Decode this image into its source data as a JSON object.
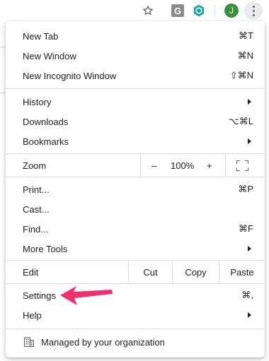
{
  "toolbar": {
    "star_icon": "star-icon",
    "ext_g_letter": "G",
    "avatar_letter": "J",
    "colors": {
      "avatar": "#3c8f3c",
      "ext_hex": "#1aa5a5"
    }
  },
  "menu": {
    "group1": [
      {
        "label": "New Tab",
        "shortcut": "⌘T"
      },
      {
        "label": "New Window",
        "shortcut": "⌘N"
      },
      {
        "label": "New Incognito Window",
        "shortcut": "⇧⌘N"
      }
    ],
    "group2": [
      {
        "label": "History",
        "submenu": true
      },
      {
        "label": "Downloads",
        "shortcut": "⌥⌘L"
      },
      {
        "label": "Bookmarks",
        "submenu": true
      }
    ],
    "zoom": {
      "label": "Zoom",
      "minus": "–",
      "value": "100%",
      "plus": "+"
    },
    "group3": [
      {
        "label": "Print...",
        "shortcut": "⌘P"
      },
      {
        "label": "Cast..."
      },
      {
        "label": "Find...",
        "shortcut": "⌘F"
      },
      {
        "label": "More Tools",
        "submenu": true
      }
    ],
    "edit": {
      "label": "Edit",
      "cut": "Cut",
      "copy": "Copy",
      "paste": "Paste"
    },
    "group4": [
      {
        "label": "Settings",
        "shortcut": "⌘,"
      },
      {
        "label": "Help",
        "submenu": true
      }
    ],
    "managed": {
      "label": "Managed by your organization"
    }
  },
  "annotation": {
    "color": "#f0306e"
  }
}
